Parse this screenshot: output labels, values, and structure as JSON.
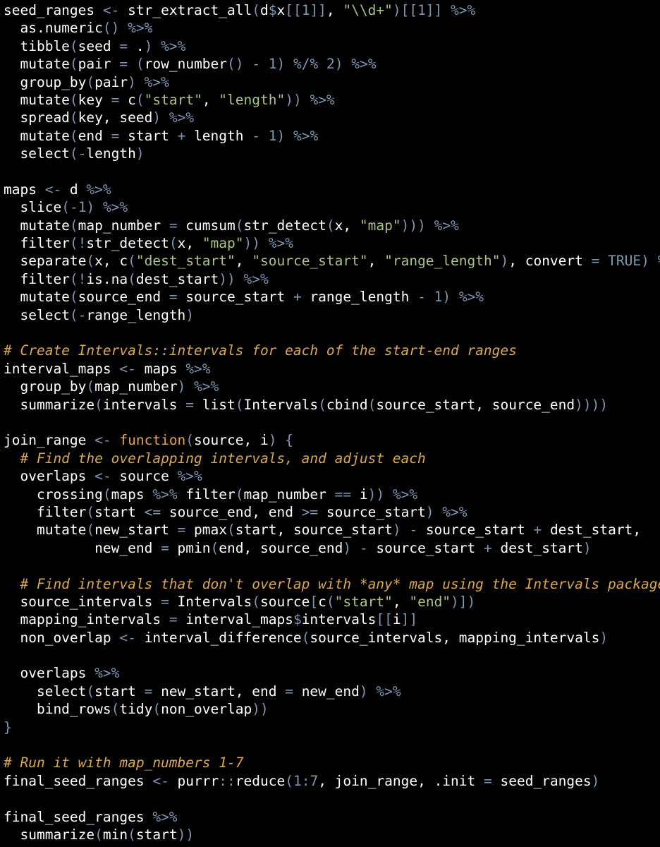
{
  "colors": {
    "background": "#000000",
    "identifier": "#ffffff",
    "operator": "#7f97b2",
    "string": "#a8c386",
    "keyword": "#e2a64f",
    "comment": "#d8a752"
  },
  "lines": [
    [
      [
        "id",
        "seed_ranges "
      ],
      [
        "op",
        "<-"
      ],
      [
        "id",
        " str_extract_all"
      ],
      [
        "pn",
        "("
      ],
      [
        "id",
        "d"
      ],
      [
        "op",
        "$"
      ],
      [
        "id",
        "x"
      ],
      [
        "pn",
        "[[1]]"
      ],
      [
        "id",
        ", "
      ],
      [
        "str",
        "\"\\\\d+\""
      ],
      [
        "pn",
        ")[[1]]"
      ],
      [
        "id",
        " "
      ],
      [
        "op",
        "%>%"
      ]
    ],
    [
      [
        "id",
        "  as.numeric"
      ],
      [
        "pn",
        "()"
      ],
      [
        "id",
        " "
      ],
      [
        "op",
        "%>%"
      ]
    ],
    [
      [
        "id",
        "  tibble"
      ],
      [
        "pn",
        "("
      ],
      [
        "id",
        "seed "
      ],
      [
        "op",
        "="
      ],
      [
        "id",
        " ."
      ],
      [
        "pn",
        ")"
      ],
      [
        "id",
        " "
      ],
      [
        "op",
        "%>%"
      ]
    ],
    [
      [
        "id",
        "  mutate"
      ],
      [
        "pn",
        "("
      ],
      [
        "id",
        "pair "
      ],
      [
        "op",
        "="
      ],
      [
        "id",
        " "
      ],
      [
        "pn",
        "("
      ],
      [
        "id",
        "row_number"
      ],
      [
        "pn",
        "()"
      ],
      [
        "id",
        " "
      ],
      [
        "op",
        "-"
      ],
      [
        "id",
        " "
      ],
      [
        "num",
        "1"
      ],
      [
        "pn",
        ")"
      ],
      [
        "id",
        " "
      ],
      [
        "op",
        "%/%"
      ],
      [
        "id",
        " "
      ],
      [
        "num",
        "2"
      ],
      [
        "pn",
        ")"
      ],
      [
        "id",
        " "
      ],
      [
        "op",
        "%>%"
      ]
    ],
    [
      [
        "id",
        "  group_by"
      ],
      [
        "pn",
        "("
      ],
      [
        "id",
        "pair"
      ],
      [
        "pn",
        ")"
      ],
      [
        "id",
        " "
      ],
      [
        "op",
        "%>%"
      ]
    ],
    [
      [
        "id",
        "  mutate"
      ],
      [
        "pn",
        "("
      ],
      [
        "id",
        "key "
      ],
      [
        "op",
        "="
      ],
      [
        "id",
        " c"
      ],
      [
        "pn",
        "("
      ],
      [
        "str",
        "\"start\""
      ],
      [
        "id",
        ", "
      ],
      [
        "str",
        "\"length\""
      ],
      [
        "pn",
        "))"
      ],
      [
        "id",
        " "
      ],
      [
        "op",
        "%>%"
      ]
    ],
    [
      [
        "id",
        "  spread"
      ],
      [
        "pn",
        "("
      ],
      [
        "id",
        "key, seed"
      ],
      [
        "pn",
        ")"
      ],
      [
        "id",
        " "
      ],
      [
        "op",
        "%>%"
      ]
    ],
    [
      [
        "id",
        "  mutate"
      ],
      [
        "pn",
        "("
      ],
      [
        "id",
        "end "
      ],
      [
        "op",
        "="
      ],
      [
        "id",
        " start "
      ],
      [
        "op",
        "+"
      ],
      [
        "id",
        " length "
      ],
      [
        "op",
        "-"
      ],
      [
        "id",
        " "
      ],
      [
        "num",
        "1"
      ],
      [
        "pn",
        ")"
      ],
      [
        "id",
        " "
      ],
      [
        "op",
        "%>%"
      ]
    ],
    [
      [
        "id",
        "  select"
      ],
      [
        "pn",
        "("
      ],
      [
        "op",
        "-"
      ],
      [
        "id",
        "length"
      ],
      [
        "pn",
        ")"
      ]
    ],
    [],
    [
      [
        "id",
        "maps "
      ],
      [
        "op",
        "<-"
      ],
      [
        "id",
        " d "
      ],
      [
        "op",
        "%>%"
      ]
    ],
    [
      [
        "id",
        "  slice"
      ],
      [
        "pn",
        "("
      ],
      [
        "op",
        "-"
      ],
      [
        "num",
        "1"
      ],
      [
        "pn",
        ")"
      ],
      [
        "id",
        " "
      ],
      [
        "op",
        "%>%"
      ]
    ],
    [
      [
        "id",
        "  mutate"
      ],
      [
        "pn",
        "("
      ],
      [
        "id",
        "map_number "
      ],
      [
        "op",
        "="
      ],
      [
        "id",
        " cumsum"
      ],
      [
        "pn",
        "("
      ],
      [
        "id",
        "str_detect"
      ],
      [
        "pn",
        "("
      ],
      [
        "id",
        "x, "
      ],
      [
        "str",
        "\"map\""
      ],
      [
        "pn",
        ")))"
      ],
      [
        "id",
        " "
      ],
      [
        "op",
        "%>%"
      ]
    ],
    [
      [
        "id",
        "  filter"
      ],
      [
        "pn",
        "("
      ],
      [
        "op",
        "!"
      ],
      [
        "id",
        "str_detect"
      ],
      [
        "pn",
        "("
      ],
      [
        "id",
        "x, "
      ],
      [
        "str",
        "\"map\""
      ],
      [
        "pn",
        "))"
      ],
      [
        "id",
        " "
      ],
      [
        "op",
        "%>%"
      ]
    ],
    [
      [
        "id",
        "  separate"
      ],
      [
        "pn",
        "("
      ],
      [
        "id",
        "x, c"
      ],
      [
        "pn",
        "("
      ],
      [
        "str",
        "\"dest_start\""
      ],
      [
        "id",
        ", "
      ],
      [
        "str",
        "\"source_start\""
      ],
      [
        "id",
        ", "
      ],
      [
        "str",
        "\"range_length\""
      ],
      [
        "pn",
        ")"
      ],
      [
        "id",
        ", convert "
      ],
      [
        "op",
        "="
      ],
      [
        "id",
        " "
      ],
      [
        "num",
        "TRUE"
      ],
      [
        "pn",
        ")"
      ],
      [
        "id",
        " "
      ],
      [
        "op",
        "%>%"
      ]
    ],
    [
      [
        "id",
        "  filter"
      ],
      [
        "pn",
        "("
      ],
      [
        "op",
        "!"
      ],
      [
        "id",
        "is.na"
      ],
      [
        "pn",
        "("
      ],
      [
        "id",
        "dest_start"
      ],
      [
        "pn",
        "))"
      ],
      [
        "id",
        " "
      ],
      [
        "op",
        "%>%"
      ]
    ],
    [
      [
        "id",
        "  mutate"
      ],
      [
        "pn",
        "("
      ],
      [
        "id",
        "source_end "
      ],
      [
        "op",
        "="
      ],
      [
        "id",
        " source_start "
      ],
      [
        "op",
        "+"
      ],
      [
        "id",
        " range_length "
      ],
      [
        "op",
        "-"
      ],
      [
        "id",
        " "
      ],
      [
        "num",
        "1"
      ],
      [
        "pn",
        ")"
      ],
      [
        "id",
        " "
      ],
      [
        "op",
        "%>%"
      ]
    ],
    [
      [
        "id",
        "  select"
      ],
      [
        "pn",
        "("
      ],
      [
        "op",
        "-"
      ],
      [
        "id",
        "range_length"
      ],
      [
        "pn",
        ")"
      ]
    ],
    [],
    [
      [
        "cmt",
        "# Create Intervals::intervals for each of the start-end ranges"
      ]
    ],
    [
      [
        "id",
        "interval_maps "
      ],
      [
        "op",
        "<-"
      ],
      [
        "id",
        " maps "
      ],
      [
        "op",
        "%>%"
      ]
    ],
    [
      [
        "id",
        "  group_by"
      ],
      [
        "pn",
        "("
      ],
      [
        "id",
        "map_number"
      ],
      [
        "pn",
        ")"
      ],
      [
        "id",
        " "
      ],
      [
        "op",
        "%>%"
      ]
    ],
    [
      [
        "id",
        "  summarize"
      ],
      [
        "pn",
        "("
      ],
      [
        "id",
        "intervals "
      ],
      [
        "op",
        "="
      ],
      [
        "id",
        " list"
      ],
      [
        "pn",
        "("
      ],
      [
        "id",
        "Intervals"
      ],
      [
        "pn",
        "("
      ],
      [
        "id",
        "cbind"
      ],
      [
        "pn",
        "("
      ],
      [
        "id",
        "source_start, source_end"
      ],
      [
        "pn",
        "))))"
      ]
    ],
    [],
    [
      [
        "id",
        "join_range "
      ],
      [
        "op",
        "<-"
      ],
      [
        "id",
        " "
      ],
      [
        "kw",
        "function"
      ],
      [
        "pn",
        "("
      ],
      [
        "id",
        "source, i"
      ],
      [
        "pn",
        ")"
      ],
      [
        "id",
        " "
      ],
      [
        "pn",
        "{"
      ]
    ],
    [
      [
        "id",
        "  "
      ],
      [
        "cmt",
        "# Find the overlapping intervals, and adjust each"
      ]
    ],
    [
      [
        "id",
        "  overlaps "
      ],
      [
        "op",
        "<-"
      ],
      [
        "id",
        " source "
      ],
      [
        "op",
        "%>%"
      ]
    ],
    [
      [
        "id",
        "    crossing"
      ],
      [
        "pn",
        "("
      ],
      [
        "id",
        "maps "
      ],
      [
        "op",
        "%>%"
      ],
      [
        "id",
        " filter"
      ],
      [
        "pn",
        "("
      ],
      [
        "id",
        "map_number "
      ],
      [
        "op",
        "=="
      ],
      [
        "id",
        " i"
      ],
      [
        "pn",
        "))"
      ],
      [
        "id",
        " "
      ],
      [
        "op",
        "%>%"
      ]
    ],
    [
      [
        "id",
        "    filter"
      ],
      [
        "pn",
        "("
      ],
      [
        "id",
        "start "
      ],
      [
        "op",
        "<="
      ],
      [
        "id",
        " source_end, end "
      ],
      [
        "op",
        ">="
      ],
      [
        "id",
        " source_start"
      ],
      [
        "pn",
        ")"
      ],
      [
        "id",
        " "
      ],
      [
        "op",
        "%>%"
      ]
    ],
    [
      [
        "id",
        "    mutate"
      ],
      [
        "pn",
        "("
      ],
      [
        "id",
        "new_start "
      ],
      [
        "op",
        "="
      ],
      [
        "id",
        " pmax"
      ],
      [
        "pn",
        "("
      ],
      [
        "id",
        "start, source_start"
      ],
      [
        "pn",
        ")"
      ],
      [
        "id",
        " "
      ],
      [
        "op",
        "-"
      ],
      [
        "id",
        " source_start "
      ],
      [
        "op",
        "+"
      ],
      [
        "id",
        " dest_start,"
      ]
    ],
    [
      [
        "id",
        "           new_end "
      ],
      [
        "op",
        "="
      ],
      [
        "id",
        " pmin"
      ],
      [
        "pn",
        "("
      ],
      [
        "id",
        "end, source_end"
      ],
      [
        "pn",
        ")"
      ],
      [
        "id",
        " "
      ],
      [
        "op",
        "-"
      ],
      [
        "id",
        " source_start "
      ],
      [
        "op",
        "+"
      ],
      [
        "id",
        " dest_start"
      ],
      [
        "pn",
        ")"
      ]
    ],
    [],
    [
      [
        "id",
        "  "
      ],
      [
        "cmt",
        "# Find intervals that don't overlap with *any* map using the Intervals package"
      ]
    ],
    [
      [
        "id",
        "  source_intervals "
      ],
      [
        "op",
        "="
      ],
      [
        "id",
        " Intervals"
      ],
      [
        "pn",
        "("
      ],
      [
        "id",
        "source"
      ],
      [
        "pn",
        "["
      ],
      [
        "id",
        "c"
      ],
      [
        "pn",
        "("
      ],
      [
        "str",
        "\"start\""
      ],
      [
        "id",
        ", "
      ],
      [
        "str",
        "\"end\""
      ],
      [
        "pn",
        ")])"
      ]
    ],
    [
      [
        "id",
        "  mapping_intervals "
      ],
      [
        "op",
        "="
      ],
      [
        "id",
        " interval_maps"
      ],
      [
        "op",
        "$"
      ],
      [
        "id",
        "intervals"
      ],
      [
        "pn",
        "[["
      ],
      [
        "id",
        "i"
      ],
      [
        "pn",
        "]]"
      ]
    ],
    [
      [
        "id",
        "  non_overlap "
      ],
      [
        "op",
        "<-"
      ],
      [
        "id",
        " interval_difference"
      ],
      [
        "pn",
        "("
      ],
      [
        "id",
        "source_intervals, mapping_intervals"
      ],
      [
        "pn",
        ")"
      ]
    ],
    [],
    [
      [
        "id",
        "  overlaps "
      ],
      [
        "op",
        "%>%"
      ]
    ],
    [
      [
        "id",
        "    select"
      ],
      [
        "pn",
        "("
      ],
      [
        "id",
        "start "
      ],
      [
        "op",
        "="
      ],
      [
        "id",
        " new_start, end "
      ],
      [
        "op",
        "="
      ],
      [
        "id",
        " new_end"
      ],
      [
        "pn",
        ")"
      ],
      [
        "id",
        " "
      ],
      [
        "op",
        "%>%"
      ]
    ],
    [
      [
        "id",
        "    bind_rows"
      ],
      [
        "pn",
        "("
      ],
      [
        "id",
        "tidy"
      ],
      [
        "pn",
        "("
      ],
      [
        "id",
        "non_overlap"
      ],
      [
        "pn",
        "))"
      ]
    ],
    [
      [
        "pn",
        "}"
      ]
    ],
    [],
    [
      [
        "cmt",
        "# Run it with map_numbers 1-7"
      ]
    ],
    [
      [
        "id",
        "final_seed_ranges "
      ],
      [
        "op",
        "<-"
      ],
      [
        "id",
        " purrr"
      ],
      [
        "op",
        "::"
      ],
      [
        "id",
        "reduce"
      ],
      [
        "pn",
        "("
      ],
      [
        "num",
        "1"
      ],
      [
        "op",
        ":"
      ],
      [
        "num",
        "7"
      ],
      [
        "id",
        ", join_range, .init "
      ],
      [
        "op",
        "="
      ],
      [
        "id",
        " seed_ranges"
      ],
      [
        "pn",
        ")"
      ]
    ],
    [],
    [
      [
        "id",
        "final_seed_ranges "
      ],
      [
        "op",
        "%>%"
      ]
    ],
    [
      [
        "id",
        "  summarize"
      ],
      [
        "pn",
        "("
      ],
      [
        "id",
        "min"
      ],
      [
        "pn",
        "("
      ],
      [
        "id",
        "start"
      ],
      [
        "pn",
        "))"
      ]
    ]
  ]
}
